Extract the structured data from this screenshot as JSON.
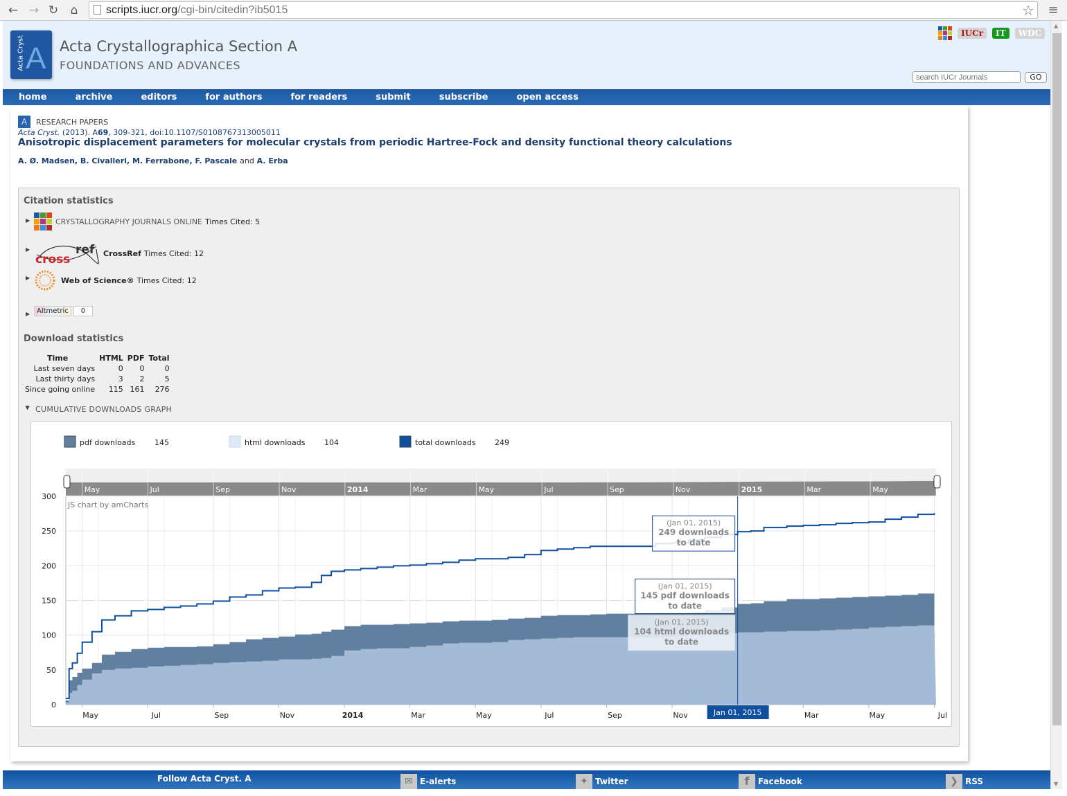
{
  "browser": {
    "url_host": "scripts.iucr.org",
    "url_path": "/cgi-bin/citedin?ib5015",
    "back_icon": "arrow-left-icon",
    "forward_icon": "arrow-right-icon",
    "reload_icon": "reload-icon",
    "home_icon": "home-icon",
    "bookmark_icon": "star-icon",
    "menu_icon": "hamburger-icon"
  },
  "header": {
    "logo_vertical": "Acta Cryst",
    "logo_letter": "A",
    "title": "Acta Crystallographica Section A",
    "subtitle": "FOUNDATIONS AND ADVANCES",
    "badges": [
      "IUCr",
      "IT",
      "WDC"
    ],
    "search_placeholder": "search IUCr Journals",
    "go_label": "GO"
  },
  "nav": [
    "home",
    "archive",
    "editors",
    "for authors",
    "for readers",
    "submit",
    "subscribe",
    "open access"
  ],
  "article": {
    "section_letter": "A",
    "section": "RESEARCH PAPERS",
    "journal": "Acta Cryst.",
    "year": "(2013). A",
    "volume": "69",
    "pages_doi": ", 309-321, doi:10.1107/S0108767313005011",
    "title": "Anisotropic displacement parameters for molecular crystals from periodic Hartree-Fock and density functional theory calculations",
    "authors_main": "A. Ø. Madsen, B. Civalleri, M. Ferrabone, F. Pascale",
    "authors_and": "and",
    "authors_last": "A. Erba"
  },
  "citations": {
    "heading": "Citation statistics",
    "rows": [
      {
        "source": "CRYSTALLOGRAPHY JOURNALS ONLINE",
        "label": "Times Cited: 5"
      },
      {
        "source": "CrossRef",
        "label": "Times Cited: 12"
      },
      {
        "source": "Web of Science®",
        "label": "Times Cited: 12"
      }
    ],
    "altmetric_label": "Altmetric",
    "altmetric_score": "0"
  },
  "downloads": {
    "heading": "Download statistics",
    "columns": [
      "Time",
      "HTML",
      "PDF",
      "Total"
    ],
    "rows": [
      [
        "Last seven days",
        "0",
        "0",
        "0"
      ],
      [
        "Last thirty days",
        "3",
        "2",
        "5"
      ],
      [
        "Since going online",
        "115",
        "161",
        "276"
      ]
    ],
    "graph_toggle": "CUMULATIVE DOWNLOADS GRAPH"
  },
  "chart_data": {
    "type": "area",
    "title": "",
    "credit": "JS chart by amCharts",
    "xlabel": "",
    "ylabel": "",
    "x_unit": "months since Jan 2013",
    "xlim": [
      3.5,
      18.0
    ],
    "ylim": [
      0,
      300
    ],
    "yticks": [
      0,
      50,
      100,
      150,
      200,
      250,
      300
    ],
    "xticks": [
      {
        "m": 4,
        "label": "May",
        "bold": false
      },
      {
        "m": 6,
        "label": "Jul",
        "bold": false
      },
      {
        "m": 8,
        "label": "Sep",
        "bold": false
      },
      {
        "m": 10,
        "label": "Nov",
        "bold": false
      },
      {
        "m": 12,
        "label": "2014",
        "bold": true
      },
      {
        "m": 14,
        "label": "Mar",
        "bold": false
      },
      {
        "m": 16,
        "label": "May",
        "bold": false
      },
      {
        "m": 18,
        "label": "Jul",
        "bold": false
      },
      {
        "m": 20,
        "label": "Sep",
        "bold": false
      },
      {
        "m": 22,
        "label": "Nov",
        "bold": false
      },
      {
        "m": 24,
        "label": "2015",
        "bold": true
      },
      {
        "m": 26,
        "label": "Mar",
        "bold": false
      },
      {
        "m": 28,
        "label": "May",
        "bold": false
      },
      {
        "m": 30,
        "label": "Jul",
        "bold": false
      }
    ],
    "x": [
      3.5,
      3.6,
      3.7,
      3.85,
      4.0,
      4.3,
      4.6,
      5.0,
      5.5,
      6.0,
      6.5,
      7.0,
      7.5,
      8.0,
      8.5,
      9.0,
      9.5,
      10.0,
      10.5,
      11.0,
      11.3,
      11.6,
      12.0,
      12.5,
      13.0,
      13.5,
      14.0,
      14.5,
      15.0,
      15.5,
      16.0,
      16.5,
      17.0,
      17.5,
      18.0,
      18.5,
      19.0,
      19.5,
      20.0,
      20.5,
      21.0,
      21.5,
      22.0,
      22.5,
      23.0,
      23.5,
      24.0,
      24.4,
      24.8,
      25.5,
      26.0,
      26.5,
      27.0,
      27.5,
      28.0,
      28.5,
      29.0,
      29.5,
      30.0
    ],
    "series": [
      {
        "name": "html downloads",
        "color": "#a3bbd7",
        "total_label": "104",
        "values": [
          3,
          17,
          20,
          28,
          36,
          45,
          50,
          52,
          53,
          55,
          56,
          57,
          58,
          60,
          61,
          62,
          63,
          65,
          65,
          66,
          67,
          70,
          78,
          80,
          81,
          81,
          83,
          85,
          88,
          89,
          89,
          90,
          93,
          94,
          95,
          96,
          97,
          97,
          97,
          97,
          97,
          97,
          98,
          100,
          102,
          103,
          104,
          104,
          105,
          106,
          106,
          107,
          108,
          109,
          111,
          112,
          113,
          114,
          115
        ]
      },
      {
        "name": "pdf downloads",
        "color": "#617f9f",
        "total_label": "145",
        "values": [
          6,
          35,
          40,
          46,
          52,
          60,
          72,
          76,
          80,
          82,
          83,
          83,
          84,
          87,
          90,
          94,
          96,
          98,
          101,
          102,
          105,
          108,
          113,
          115,
          115,
          116,
          117,
          118,
          120,
          121,
          121,
          122,
          124,
          125,
          128,
          129,
          129,
          130,
          131,
          131,
          131,
          132,
          132,
          133,
          136,
          140,
          145,
          146,
          149,
          152,
          152,
          153,
          154,
          155,
          156,
          157,
          158,
          160,
          161
        ]
      },
      {
        "name": "total downloads",
        "color": "#0e4f9f",
        "total_label": "249",
        "values": [
          9,
          52,
          60,
          74,
          90,
          105,
          122,
          128,
          135,
          137,
          140,
          142,
          145,
          149,
          155,
          158,
          164,
          168,
          169,
          176,
          186,
          192,
          194,
          196,
          198,
          200,
          201,
          203,
          205,
          208,
          210,
          210,
          212,
          216,
          222,
          224,
          226,
          228,
          228,
          228,
          228,
          232,
          233,
          237,
          241,
          245,
          249,
          250,
          255,
          257,
          258,
          259,
          261,
          262,
          263,
          267,
          270,
          274,
          276
        ]
      }
    ],
    "legend": [
      {
        "name": "pdf downloads",
        "value": "145",
        "color": "#617f9f"
      },
      {
        "name": "html downloads",
        "value": "104",
        "color": "#ddeaf8"
      },
      {
        "name": "total downloads",
        "value": "249",
        "color": "#0e4f9f"
      }
    ],
    "legend_position": "top",
    "cursor": {
      "m": 24,
      "date_label": "Jan 01, 2015",
      "balloons": [
        {
          "date": "(Jan 01, 2015)",
          "line1": "249 downloads",
          "line2": "to date"
        },
        {
          "date": "(Jan 01, 2015)",
          "line1": "145 pdf downloads",
          "line2": "to date"
        },
        {
          "date": "(Jan 01, 2015)",
          "line1": "104 html downloads",
          "line2": "to date"
        }
      ]
    },
    "scrollbar": {
      "labels": [
        {
          "m": 4,
          "label": "May"
        },
        {
          "m": 6,
          "label": "Jul"
        },
        {
          "m": 8,
          "label": "Sep"
        },
        {
          "m": 10,
          "label": "Nov"
        },
        {
          "m": 12,
          "label": "2014"
        },
        {
          "m": 14,
          "label": "Mar"
        },
        {
          "m": 16,
          "label": "May"
        },
        {
          "m": 18,
          "label": "Jul"
        },
        {
          "m": 20,
          "label": "Sep"
        },
        {
          "m": 22,
          "label": "Nov"
        },
        {
          "m": 24,
          "label": "2015"
        },
        {
          "m": 26,
          "label": "Mar"
        },
        {
          "m": 28,
          "label": "May"
        },
        {
          "m": 30,
          "label": "Jul"
        }
      ]
    }
  },
  "footer": {
    "follow": "Follow Acta Cryst. A",
    "links": [
      {
        "label": "E-alerts",
        "icon": "envelope-icon"
      },
      {
        "label": "Twitter",
        "icon": "twitter-bird-icon"
      },
      {
        "label": "Facebook",
        "icon": "facebook-f-icon"
      },
      {
        "label": "RSS",
        "icon": "rss-feed-icon"
      }
    ]
  }
}
